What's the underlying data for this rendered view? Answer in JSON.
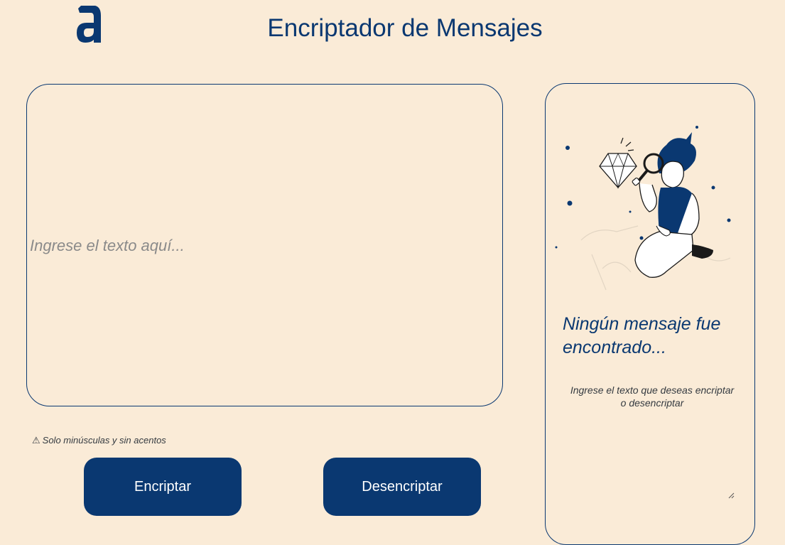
{
  "header": {
    "logo_icon": "alura-a-logo",
    "title": "Encriptador de Mensajes"
  },
  "input": {
    "placeholder": "Ingrese el texto aquí...",
    "value": ""
  },
  "warning": {
    "icon": "⚠",
    "text": "Solo minúsculas y sin acentos"
  },
  "buttons": {
    "encrypt_label": "Encriptar",
    "decrypt_label": "Desencriptar"
  },
  "output": {
    "illustration": "person-with-magnifying-glass-illustration",
    "empty_title": "Ningún mensaje fue encontrado...",
    "empty_subtitle": "Ingrese el texto que deseas encriptar o desencriptar"
  },
  "colors": {
    "background": "#FAEBD7",
    "primary": "#0A3871",
    "muted_text": "#343A40",
    "placeholder": "#8A8A8A"
  }
}
